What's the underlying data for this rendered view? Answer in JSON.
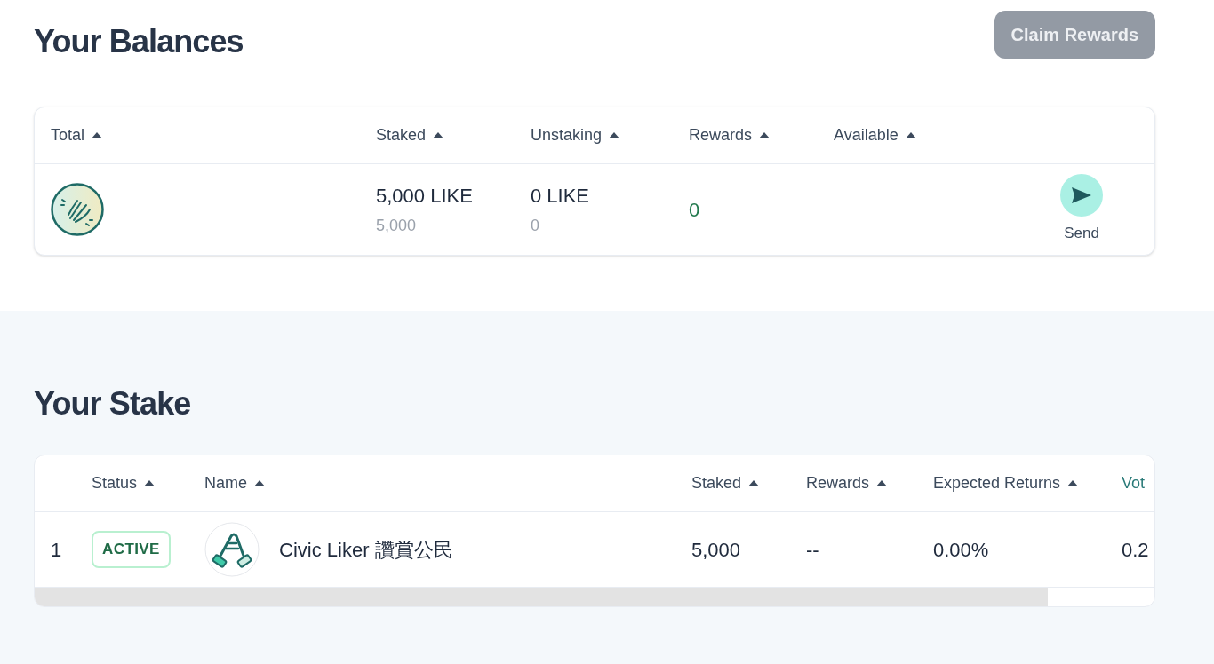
{
  "balances": {
    "title": "Your Balances",
    "claim_button": {
      "label": "Claim Rewards",
      "disabled": true
    },
    "columns": [
      "Total",
      "Staked",
      "Unstaking",
      "Rewards",
      "Available"
    ],
    "row": {
      "staked": "5,000 LIKE",
      "staked_sub": "5,000",
      "unstaking": "0 LIKE",
      "unstaking_sub": "0",
      "rewards": "0",
      "send_label": "Send"
    }
  },
  "stake": {
    "title": "Your Stake",
    "columns": [
      "Status",
      "Name",
      "Staked",
      "Rewards",
      "Expected Returns",
      "Vot"
    ],
    "rows": [
      {
        "index": "1",
        "status": "ACTIVE",
        "name": "Civic Liker 讚賞公民",
        "staked": "5,000",
        "rewards": "--",
        "expected_returns": "0.00%",
        "column_6": "0.2"
      }
    ]
  }
}
